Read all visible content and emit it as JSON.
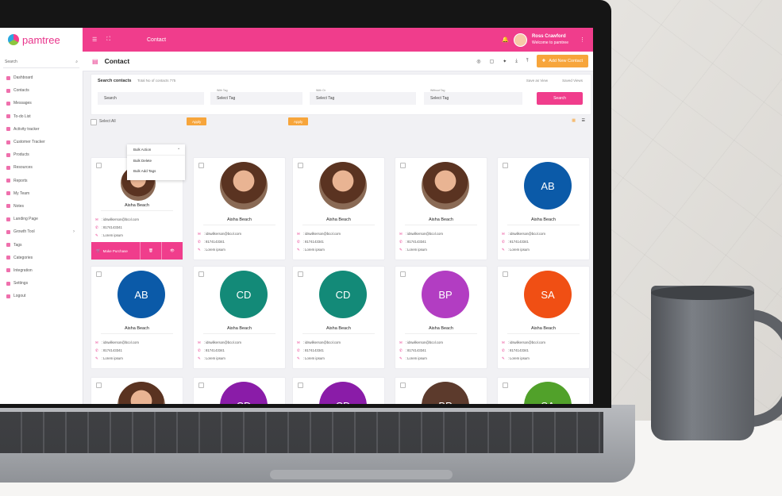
{
  "app": {
    "logo_text": "pamtree",
    "window_title": "Contact"
  },
  "sidebar": {
    "search_label": "Search",
    "items": [
      {
        "label": "Dashboard"
      },
      {
        "label": "Contacts"
      },
      {
        "label": "Messages"
      },
      {
        "label": "To-do List"
      },
      {
        "label": "Activity tracker"
      },
      {
        "label": "Customer Tracker"
      },
      {
        "label": "Products"
      },
      {
        "label": "Resources"
      },
      {
        "label": "Reports"
      },
      {
        "label": "My Team"
      },
      {
        "label": "Notes"
      },
      {
        "label": "Landing Page"
      },
      {
        "label": "Growth Tool"
      },
      {
        "label": "Tags"
      },
      {
        "label": "Categories"
      },
      {
        "label": "Integration"
      },
      {
        "label": "Settings"
      },
      {
        "label": "Logout"
      }
    ]
  },
  "topbar": {
    "title": "Contact",
    "user_name": "Ross Crawford",
    "user_greeting": "Welcome to pamtree"
  },
  "header": {
    "title": "Contact",
    "add_button": "Add New Contact"
  },
  "search_panel": {
    "title": "Search contacts",
    "subtitle": "Total No of contacts 775",
    "save_view": "Save as View",
    "saved_views": "Saved Views",
    "search_value": "Search",
    "with_tag_label": "With Tag",
    "with_tag_value": "Select Tag",
    "with_or_label": "With Or",
    "with_or_value": "Select Tag",
    "without_tag_label": "Without Tag",
    "without_tag_value": "Select Tag",
    "search_button": "Search"
  },
  "bulk": {
    "select_all": "Select All",
    "bulk_action": "Bulk Action",
    "apply": "Apply",
    "apply2": "Apply",
    "options": [
      "Bulk Delete",
      "Bulk Add Tags"
    ]
  },
  "cards": [
    {
      "initials": "",
      "name": "Aisha Beach",
      "email": ": idswilkerson@bcol.com",
      "phone": ": 8174143341",
      "note": ": Lorem ipsum",
      "photo": true,
      "color": "",
      "actions": {
        "make_purchase": "Make Purchase"
      }
    },
    {
      "initials": "",
      "name": "Aisha Beach",
      "email": ": idswilkerson@bcol.com",
      "phone": ": 8174143341",
      "note": ": Lorem ipsum",
      "photo": true,
      "color": ""
    },
    {
      "initials": "",
      "name": "Aisha Beach",
      "email": ": idswilkerson@bcol.com",
      "phone": ": 8174143341",
      "note": ": Lorem ipsum",
      "photo": true,
      "color": ""
    },
    {
      "initials": "",
      "name": "Aisha Beach",
      "email": ": idswilkerson@bcol.com",
      "phone": ": 8174143341",
      "note": ": Lorem ipsum",
      "photo": true,
      "color": ""
    },
    {
      "initials": "AB",
      "name": "Aisha Beach",
      "email": ": idswilkerson@bcol.com",
      "phone": ": 8174143341",
      "note": ": Lorem ipsum",
      "photo": false,
      "color": "#0b5aa8"
    },
    {
      "initials": "AB",
      "name": "Aisha Beach",
      "email": ": idswilkerson@bcol.com",
      "phone": ": 8174143341",
      "note": ": Lorem ipsum",
      "photo": false,
      "color": "#0b5aa8"
    },
    {
      "initials": "CD",
      "name": "Aisha Beach",
      "email": ": idswilkerson@bcol.com",
      "phone": ": 8174143341",
      "note": ": Lorem ipsum",
      "photo": false,
      "color": "#138a78"
    },
    {
      "initials": "CD",
      "name": "Aisha Beach",
      "email": ": idswilkerson@bcol.com",
      "phone": ": 8174143341",
      "note": ": Lorem ipsum",
      "photo": false,
      "color": "#138a78"
    },
    {
      "initials": "BP",
      "name": "Aisha Beach",
      "email": ": idswilkerson@bcol.com",
      "phone": ": 8174143341",
      "note": ": Lorem ipsum",
      "photo": false,
      "color": "#b23dc2"
    },
    {
      "initials": "SA",
      "name": "Aisha Beach",
      "email": ": idswilkerson@bcol.com",
      "phone": ": 8174143341",
      "note": ": Lorem ipsum",
      "photo": false,
      "color": "#f04f14"
    },
    {
      "initials": "",
      "name": "",
      "email": "",
      "phone": "",
      "note": "",
      "photo": true,
      "color": ""
    },
    {
      "initials": "CD",
      "name": "",
      "email": "",
      "phone": "",
      "note": "",
      "photo": false,
      "color": "#8a1ca8"
    },
    {
      "initials": "CD",
      "name": "",
      "email": "",
      "phone": "",
      "note": "",
      "photo": false,
      "color": "#8a1ca8"
    },
    {
      "initials": "BP",
      "name": "",
      "email": "",
      "phone": "",
      "note": "",
      "photo": false,
      "color": "#5c3a2c"
    },
    {
      "initials": "SA",
      "name": "",
      "email": "",
      "phone": "",
      "note": "",
      "photo": false,
      "color": "#51a12a"
    }
  ]
}
